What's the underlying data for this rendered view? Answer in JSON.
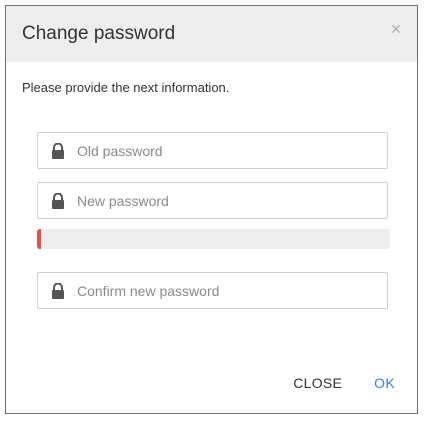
{
  "dialog": {
    "title": "Change password",
    "close_icon": "close-icon",
    "instructions": "Please provide the next information."
  },
  "fields": {
    "old_password": {
      "placeholder": "Old password",
      "value": "",
      "icon": "lock-icon"
    },
    "new_password": {
      "placeholder": "New password",
      "value": "",
      "icon": "lock-icon"
    },
    "confirm_password": {
      "placeholder": "Confirm new password",
      "value": "",
      "icon": "lock-icon"
    }
  },
  "strength_meter": {
    "level": 0.01,
    "color": "#d9534f"
  },
  "buttons": {
    "close_label": "CLOSE",
    "ok_label": "OK"
  },
  "colors": {
    "accent": "#3a7dd8",
    "header_bg": "#eeeeee"
  }
}
